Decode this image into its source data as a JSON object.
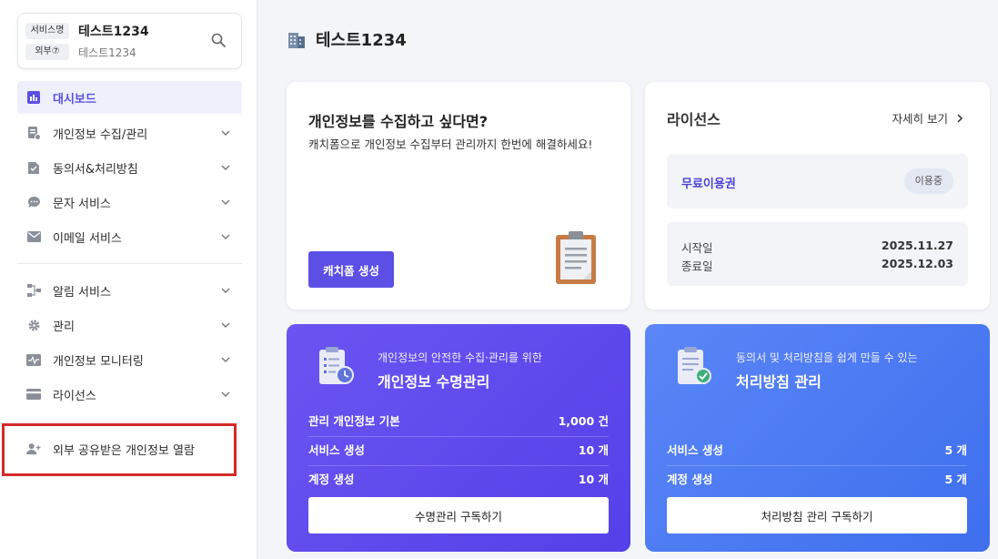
{
  "service_card": {
    "name_tag": "서비스명",
    "name": "테스트1234",
    "external_tag": "외부⑦",
    "sub": "테스트1234",
    "search_icon": "search-icon"
  },
  "sidebar": {
    "items": [
      {
        "label": "대시보드",
        "icon": "dashboard-icon",
        "active": true,
        "expandable": false
      },
      {
        "label": "개인정보 수집/관리",
        "icon": "form-icon",
        "expandable": true
      },
      {
        "label": "동의서&처리방침",
        "icon": "document-icon",
        "expandable": true
      },
      {
        "label": "문자 서비스",
        "icon": "chat-icon",
        "expandable": true
      },
      {
        "label": "이메일 서비스",
        "icon": "mail-icon",
        "expandable": true
      },
      {
        "label": "알림 서비스",
        "icon": "flow-icon",
        "expandable": true
      },
      {
        "label": "관리",
        "icon": "gear-icon",
        "expandable": true
      },
      {
        "label": "개인정보 모니터링",
        "icon": "monitor-icon",
        "expandable": true
      },
      {
        "label": "라이선스",
        "icon": "card-icon",
        "expandable": true
      },
      {
        "label": "외부 공유받은 개인정보 열람",
        "icon": "add-user-icon",
        "expandable": false
      }
    ]
  },
  "main": {
    "title": "테스트1234",
    "collect": {
      "title": "개인정보를 수집하고 싶다면?",
      "description": "캐치폼으로 개인정보 수집부터 관리까지 한번에 해결하세요!",
      "button": "캐치폼 생성"
    },
    "license": {
      "title": "라이선스",
      "more": "자세히 보기",
      "plan": "무료이용권",
      "status": "이용중",
      "start_label": "시작일",
      "start_value": "2025.11.27",
      "end_label": "종료일",
      "end_value": "2025.12.03"
    },
    "promo_lifecycle": {
      "subtitle": "개인정보의 안전한 수집·관리를 위한",
      "title": "개인정보 수명관리",
      "rows": [
        {
          "label": "관리 개인정보 기본",
          "value": "1,000 건"
        },
        {
          "label": "서비스 생성",
          "value": "10 개"
        },
        {
          "label": "계정 생성",
          "value": "10 개"
        }
      ],
      "button": "수명관리 구독하기"
    },
    "promo_policy": {
      "subtitle": "동의서 및 처리방침을 쉽게 만들 수 있는",
      "title": "처리방침 관리",
      "rows": [
        {
          "label": "서비스 생성",
          "value": "5 개"
        },
        {
          "label": "계정 생성",
          "value": "5 개"
        }
      ],
      "button": "처리방침 관리 구독하기"
    }
  },
  "colors": {
    "accent": "#5b4fe6",
    "promo_purple": "#5f4bee",
    "promo_blue": "#4a78f2",
    "highlight": "#d32a2a"
  }
}
